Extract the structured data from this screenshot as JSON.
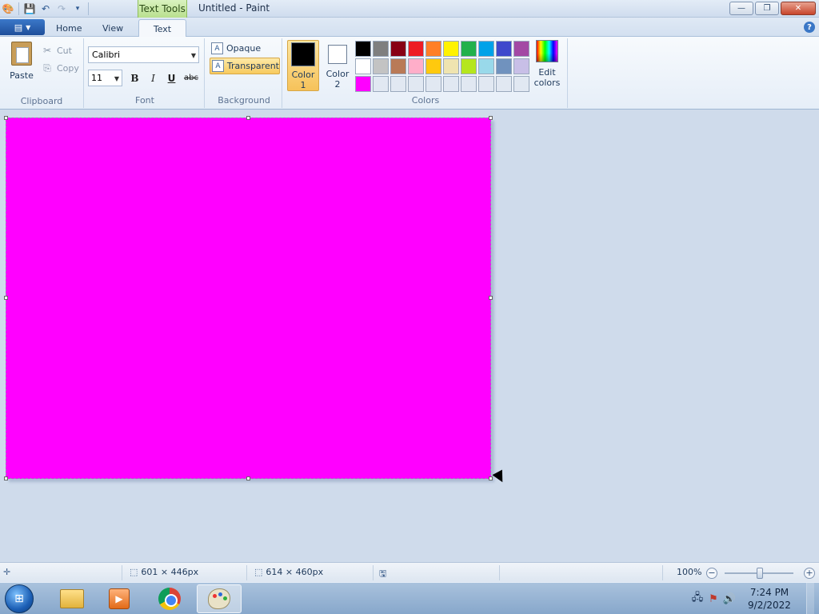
{
  "window": {
    "title": "Untitled - Paint",
    "context_tab": "Text Tools",
    "controls": {
      "minimize": "—",
      "restore": "❐",
      "close": "✕"
    }
  },
  "ribbon": {
    "tabs": [
      {
        "label": "Home"
      },
      {
        "label": "View"
      },
      {
        "label": "Text",
        "active": true
      }
    ],
    "help": "?",
    "clipboard": {
      "paste": "Paste",
      "cut": "Cut",
      "copy": "Copy",
      "group_label": "Clipboard"
    },
    "font": {
      "family": "Calibri",
      "size": "11",
      "bold": "B",
      "italic": "I",
      "underline": "U",
      "strikethrough": "abc",
      "group_label": "Font"
    },
    "background": {
      "opaque": "Opaque",
      "transparent": "Transparent",
      "group_label": "Background"
    },
    "colors": {
      "color1_line1": "Color",
      "color1_line2": "1",
      "color2_line1": "Color",
      "color2_line2": "2",
      "color1_value": "#000000",
      "color2_value": "#ffffff",
      "edit_line1": "Edit",
      "edit_line2": "colors",
      "group_label": "Colors",
      "palette": [
        "#000000",
        "#7f7f7f",
        "#880015",
        "#ed1c24",
        "#ff7f27",
        "#fff200",
        "#22b14c",
        "#00a2e8",
        "#3f48cc",
        "#a349a4",
        "#ffffff",
        "#c3c3c3",
        "#b97a57",
        "#ffaec9",
        "#ffc90e",
        "#efe4b0",
        "#b5e61d",
        "#99d9ea",
        "#7092be",
        "#c8bfe7",
        "#ff00ff",
        "#e1e8f2",
        "#e1e8f2",
        "#e1e8f2",
        "#e1e8f2",
        "#e1e8f2",
        "#e1e8f2",
        "#e1e8f2",
        "#e1e8f2",
        "#e1e8f2"
      ]
    }
  },
  "canvas": {
    "fill": "#ff00ff"
  },
  "statusbar": {
    "selection_size": "601 × 446px",
    "image_size": "614 × 460px",
    "zoom": "100%"
  },
  "taskbar": {
    "time": "7:24 PM",
    "date": "9/2/2022"
  }
}
